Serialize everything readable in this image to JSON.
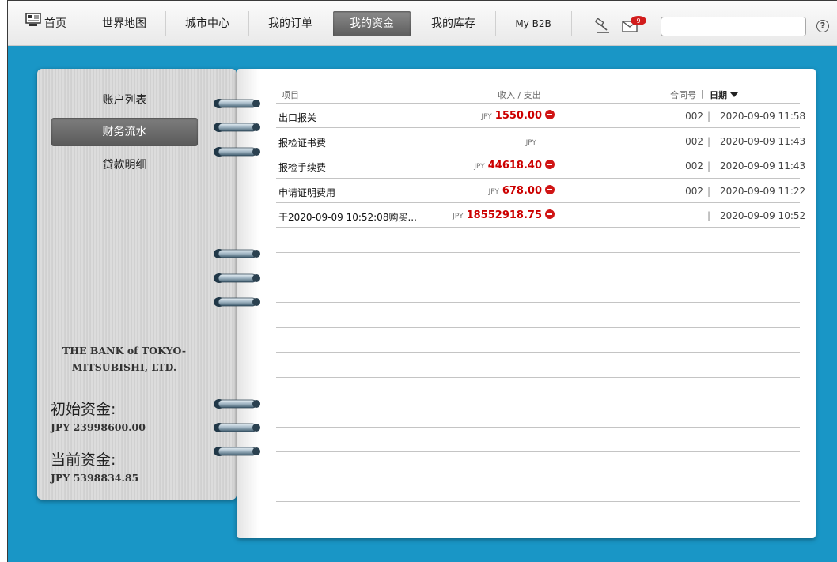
{
  "nav": {
    "home": "首页",
    "world_map": "世界地图",
    "city_center": "城市中心",
    "my_orders": "我的订单",
    "my_funds": "我的资金",
    "my_inventory": "我的库存",
    "my_b2b": "My B2B",
    "mail_badge": "9",
    "search_value": "",
    "help": "?"
  },
  "sidebar": {
    "items": [
      {
        "label": "账户列表",
        "active": false
      },
      {
        "label": "财务流水",
        "active": true
      },
      {
        "label": "贷款明细",
        "active": false
      }
    ],
    "bank_name": "THE BANK of TOKYO-MITSUBISHI, LTD.",
    "initial_funds_label": "初始资金:",
    "initial_funds_value": "JPY 23998600.00",
    "current_funds_label": "当前资金:",
    "current_funds_value": "JPY 5398834.85"
  },
  "ledger": {
    "columns": {
      "item": "项目",
      "in_out": "收入 / 支出",
      "contract": "合同号",
      "separator": "|",
      "date": "日期"
    },
    "rows": [
      {
        "item": "出口报关",
        "currency": "JPY",
        "amount": "1550.00",
        "expense": true,
        "contract": "002",
        "date": "2020-09-09 11:58"
      },
      {
        "item": "报检证书费",
        "currency": "JPY",
        "amount": "",
        "expense": false,
        "contract": "002",
        "date": "2020-09-09 11:43"
      },
      {
        "item": "报检手续费",
        "currency": "JPY",
        "amount": "44618.40",
        "expense": true,
        "contract": "002",
        "date": "2020-09-09 11:43"
      },
      {
        "item": "申请证明费用",
        "currency": "JPY",
        "amount": "678.00",
        "expense": true,
        "contract": "002",
        "date": "2020-09-09 11:22"
      },
      {
        "item": "于2020-09-09 10:52:08购买...",
        "currency": "JPY",
        "amount": "18552918.75",
        "expense": true,
        "contract": "",
        "date": "2020-09-09 10:52"
      }
    ]
  }
}
